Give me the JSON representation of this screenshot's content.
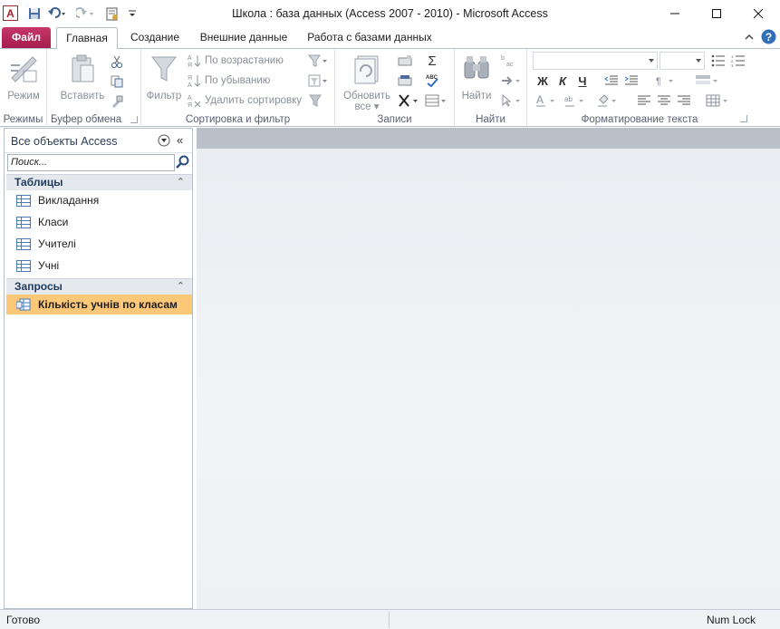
{
  "window": {
    "title": "Школа : база данных (Access 2007 - 2010)  -  Microsoft Access",
    "logo_letter": "A"
  },
  "tabs": [
    {
      "label": "Файл"
    },
    {
      "label": "Главная"
    },
    {
      "label": "Создание"
    },
    {
      "label": "Внешние данные"
    },
    {
      "label": "Работа с базами данных"
    }
  ],
  "ribbon": {
    "views": {
      "button": "Режим",
      "label": "Режимы"
    },
    "clipboard": {
      "button": "Вставить",
      "label": "Буфер обмена"
    },
    "sort_filter": {
      "button": "Фильтр",
      "ascending": "По возрастанию",
      "descending": "По убыванию",
      "remove_sort": "Удалить сортировку",
      "label": "Сортировка и фильтр"
    },
    "records": {
      "button_line1": "Обновить",
      "button_line2": "все",
      "label": "Записи"
    },
    "find": {
      "button": "Найти",
      "label": "Найти"
    },
    "text_formatting": {
      "bold": "Ж",
      "italic": "К",
      "underline": "Ч",
      "label": "Форматирование текста"
    }
  },
  "nav_pane": {
    "title": "Все объекты Access",
    "search_placeholder": "Поиск...",
    "groups": [
      {
        "label": "Таблицы",
        "items": [
          {
            "label": "Викладання"
          },
          {
            "label": "Класи"
          },
          {
            "label": "Учителі"
          },
          {
            "label": "Учні"
          }
        ]
      },
      {
        "label": "Запросы",
        "items": [
          {
            "label": "Кількість учнів по класам",
            "selected": true
          }
        ]
      }
    ]
  },
  "status_bar": {
    "left": "Готово",
    "right": "Num Lock"
  },
  "colors": {
    "file_tab": "#b82459",
    "selected_item": "#fdc778",
    "workspace": "#eef1f4"
  }
}
